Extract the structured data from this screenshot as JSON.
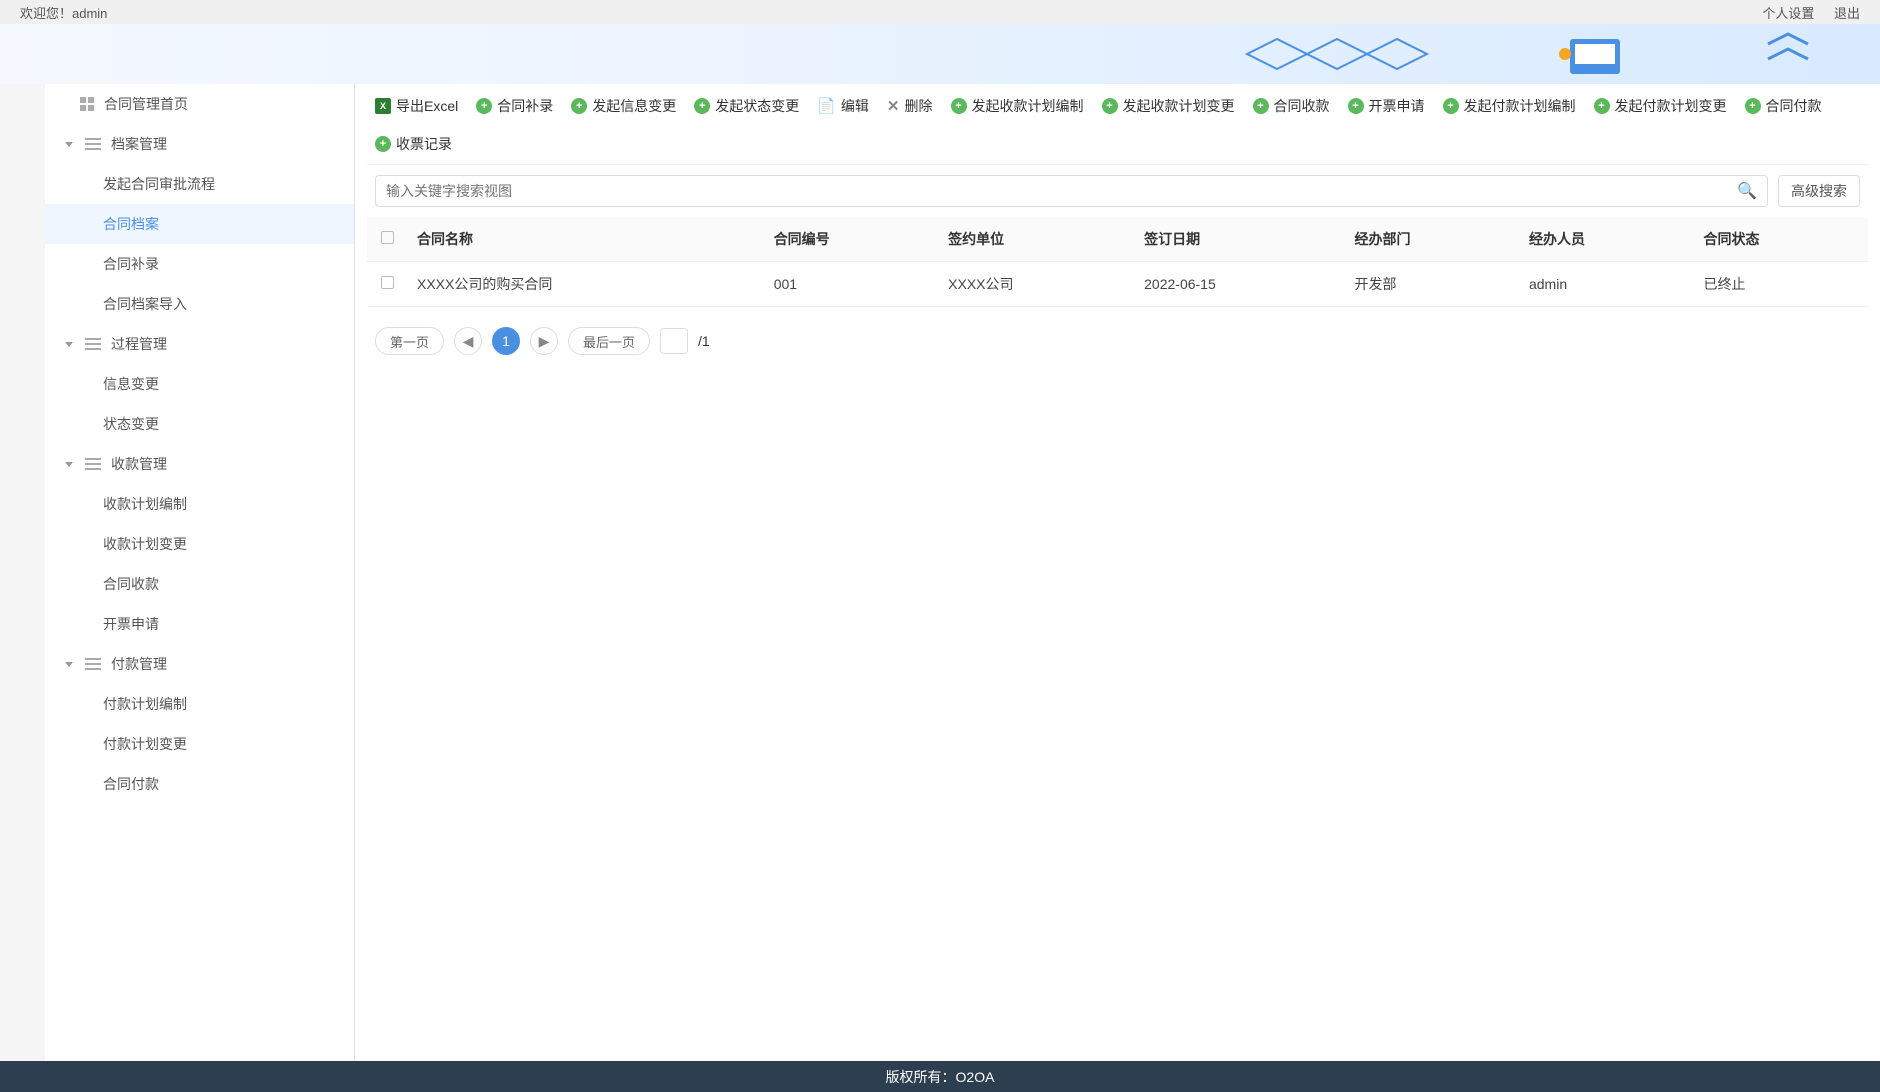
{
  "header": {
    "welcome": "欢迎您！admin",
    "personal_settings": "个人设置",
    "logout": "退出"
  },
  "sidebar": {
    "home": "合同管理首页",
    "groups": [
      {
        "label": "档案管理",
        "items": [
          "发起合同审批流程",
          "合同档案",
          "合同补录",
          "合同档案导入"
        ]
      },
      {
        "label": "过程管理",
        "items": [
          "信息变更",
          "状态变更"
        ]
      },
      {
        "label": "收款管理",
        "items": [
          "收款计划编制",
          "收款计划变更",
          "合同收款",
          "开票申请"
        ]
      },
      {
        "label": "付款管理",
        "items": [
          "付款计划编制",
          "付款计划变更",
          "合同付款"
        ]
      }
    ],
    "active_item": "合同档案"
  },
  "toolbar": {
    "export_excel": "导出Excel",
    "supplement": "合同补录",
    "info_change": "发起信息变更",
    "status_change": "发起状态变更",
    "edit": "编辑",
    "delete": "删除",
    "recv_plan": "发起收款计划编制",
    "recv_plan_change": "发起收款计划变更",
    "contract_recv": "合同收款",
    "invoice_apply": "开票申请",
    "pay_plan": "发起付款计划编制",
    "pay_plan_change": "发起付款计划变更",
    "contract_pay": "合同付款",
    "ticket_record": "收票记录"
  },
  "search": {
    "placeholder": "输入关键字搜索视图",
    "advanced": "高级搜索"
  },
  "table": {
    "headers": [
      "合同名称",
      "合同编号",
      "签约单位",
      "签订日期",
      "经办部门",
      "经办人员",
      "合同状态"
    ],
    "rows": [
      {
        "name": "XXXX公司的购买合同",
        "code": "001",
        "unit": "XXXX公司",
        "date": "2022-06-15",
        "dept": "开发部",
        "person": "admin",
        "status": "已终止"
      }
    ]
  },
  "pagination": {
    "first": "第一页",
    "last": "最后一页",
    "current": "1",
    "total": "/1"
  },
  "footer": "版权所有：O2OA"
}
